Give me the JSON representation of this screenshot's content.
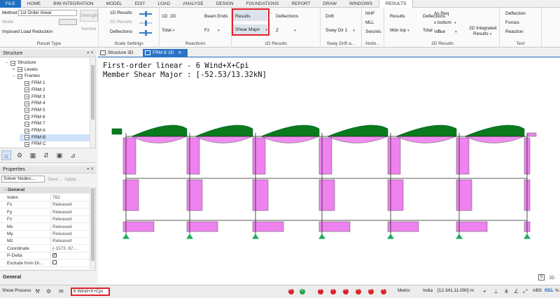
{
  "menu": {
    "items": [
      "FILE",
      "HOME",
      "BIM INTEGRATION",
      "MODEL",
      "EDIT",
      "LOAD",
      "ANALYSE",
      "DESIGN",
      "FOUNDATIONS",
      "REPORT",
      "DRAW",
      "WINDOWS",
      "RESULTS"
    ],
    "active": "RESULTS"
  },
  "ribbon": {
    "result_type": {
      "method_label": "Method",
      "method_value": "1st Order linear",
      "mode_label": "Mode",
      "imposed_label": "Imposed Load Reduction",
      "strength_label": "Strength",
      "service_label": "Service",
      "group_label": "Result Type"
    },
    "scale_settings": {
      "items": [
        "1D Results",
        "2D Results",
        "Deflections"
      ],
      "group_label": "Scale Settings"
    },
    "reactions": {
      "btn_1d": "1D",
      "btn_2d": "2D",
      "total_label": "Total",
      "beam_ends_label": "Beam Ends",
      "fz_label": "Fz",
      "group_label": "Reactions"
    },
    "results_1d": {
      "results_label": "Results",
      "shear_major_label": "Shear Major",
      "deflections_label": "Deflections",
      "z_label": "Z",
      "group_label": "1D Results"
    },
    "sway": {
      "drift_label": "Drift",
      "sway_dir_label": "Sway Dir 1",
      "group_label": "Sway Drift a..."
    },
    "notional": {
      "items": [
        "NHF",
        "MLL",
        "Seismic"
      ],
      "group_label": "Notio..."
    },
    "results_mdx": {
      "results_label": "Results",
      "mdx_label": "Mdx top"
    },
    "results_2d": {
      "deflections_label": "Deflections",
      "total_label": "Total",
      "as_req_label": "As Req",
      "x_bottom_label": "x bottom",
      "value_label": "Value",
      "integrated_label1": "2D Integrated",
      "integrated_label2": "Results",
      "group_label": "2D Results"
    },
    "text": {
      "items": [
        "Deflection",
        "Forces",
        "Reaction"
      ],
      "group_label": "Text"
    }
  },
  "structure_panel": {
    "title": "Structure",
    "pin": "▾ ✕",
    "tree": [
      {
        "label": "Structure",
        "level": 0,
        "expand": "−"
      },
      {
        "label": "Levels",
        "level": 1,
        "expand": "+"
      },
      {
        "label": "Frames",
        "level": 1,
        "expand": "−"
      },
      {
        "label": "FRM 1",
        "level": 2
      },
      {
        "label": "FRM 2",
        "level": 2
      },
      {
        "label": "FRM 3",
        "level": 2
      },
      {
        "label": "FRM 4",
        "level": 2
      },
      {
        "label": "FRM 5",
        "level": 2
      },
      {
        "label": "FRM 6",
        "level": 2
      },
      {
        "label": "FRM 7",
        "level": 2
      },
      {
        "label": "FRM A",
        "level": 2
      },
      {
        "label": "FRM B",
        "level": 2,
        "selected": true
      },
      {
        "label": "FRM C",
        "level": 2
      }
    ],
    "tools": [
      "⌂",
      "⚙",
      "▦",
      "⇵",
      "▣",
      "⊿"
    ]
  },
  "properties_panel": {
    "title": "Properties",
    "pin": "▾ ✕",
    "solver_combo": "Solver Nodes:...",
    "save_label": "Save...",
    "apply_label": "Apply...",
    "section": "General",
    "rows": [
      {
        "key": "Index",
        "value": "762"
      },
      {
        "key": "Fx",
        "value": "Released"
      },
      {
        "key": "Fy",
        "value": "Released"
      },
      {
        "key": "Fz",
        "value": "Released"
      },
      {
        "key": "Mx",
        "value": "Released"
      },
      {
        "key": "My",
        "value": "Released"
      },
      {
        "key": "Mz",
        "value": "Released"
      },
      {
        "key": "Coordinate",
        "value": "{-1573. 87..."
      },
      {
        "key": "P-Delta",
        "value": ""
      },
      {
        "key": "Exclude from Di...",
        "value": ""
      }
    ],
    "footer": "General"
  },
  "doc_tabs": [
    {
      "label": "Structure 3D",
      "active": false
    },
    {
      "label": "FRM B 2D",
      "active": true
    }
  ],
  "canvas": {
    "title_line1": "First-order linear - 6 Wind+X+Cpi",
    "title_line2": "Member Shear Major : [-52.53/13.32kN]",
    "corner_s": "S",
    "corner_n": "2D"
  },
  "statusbar": {
    "show_process": "Show Process",
    "load_case": "6 Wind+X+Cpi",
    "units": "Metric",
    "code": "India",
    "coords": "[12.341,11.090] m",
    "abs": "ABS",
    "rel": "REL",
    "pct": "%"
  },
  "colors": {
    "accent": "#2b73c7",
    "highlight_red": "#e0202a",
    "diagram_pink": "#ee82ee",
    "diagram_green": "#0a7a1c"
  }
}
